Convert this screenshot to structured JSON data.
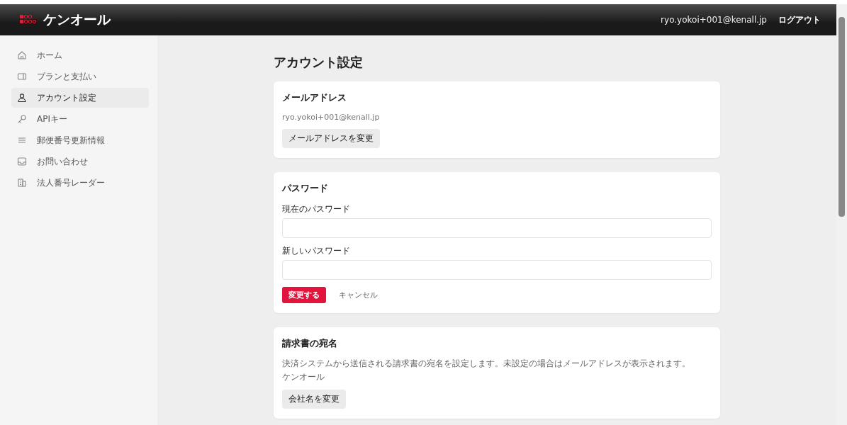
{
  "header": {
    "logo_text": "ケンオール",
    "user_email": "ryo.yokoi+001@kenall.jp",
    "logout": "ログアウト"
  },
  "sidebar": {
    "items": [
      {
        "label": "ホーム",
        "selected": false
      },
      {
        "label": "プランと支払い",
        "selected": false
      },
      {
        "label": "アカウント設定",
        "selected": true
      },
      {
        "label": "APIキー",
        "selected": false
      },
      {
        "label": "郵便番号更新情報",
        "selected": false
      },
      {
        "label": "お問い合わせ",
        "selected": false
      },
      {
        "label": "法人番号レーダー",
        "selected": false
      }
    ]
  },
  "page_title": "アカウント設定",
  "cards": [
    {
      "kind": "email",
      "title": "メールアドレス",
      "value": "ryo.yokoi+001@kenall.jp",
      "button": "メールアドレスを変更"
    },
    {
      "kind": "password",
      "title": "パスワード",
      "fields": [
        {
          "label": "現在のパスワード"
        },
        {
          "label": "新しいパスワード"
        }
      ],
      "submit": "変更する",
      "cancel": "キャンセル"
    },
    {
      "kind": "billing",
      "title": "請求書の宛名",
      "description": "決済システムから送信される請求書の宛名を設定します。未設定の場合はメールアドレスが表示されます。",
      "value": "ケンオール",
      "button": "会社名を変更"
    }
  ]
}
